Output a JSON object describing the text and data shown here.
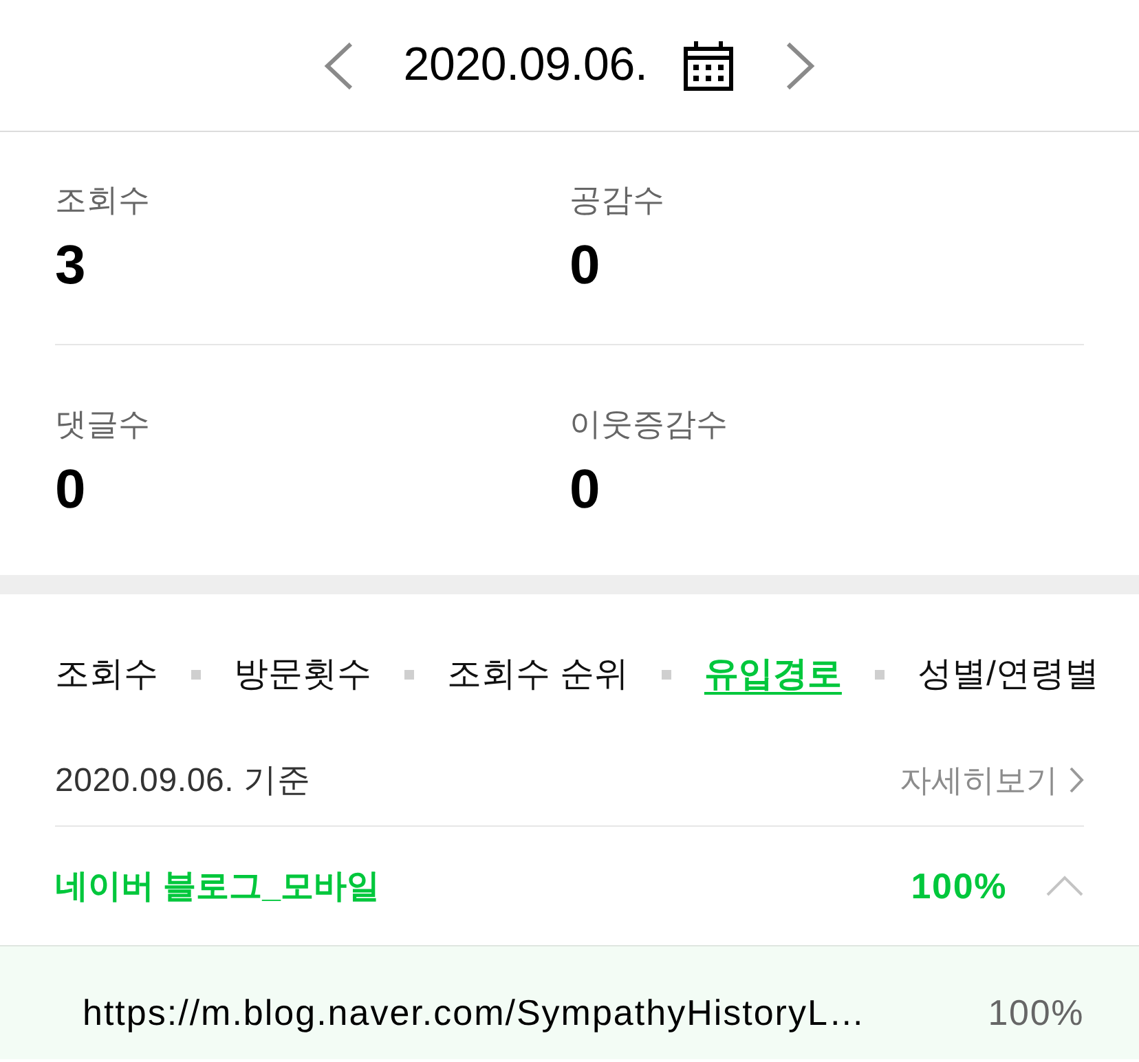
{
  "date_nav": {
    "date": "2020.09.06."
  },
  "stats": [
    {
      "label": "조회수",
      "value": "3"
    },
    {
      "label": "공감수",
      "value": "0"
    },
    {
      "label": "댓글수",
      "value": "0"
    },
    {
      "label": "이웃증감수",
      "value": "0"
    }
  ],
  "tabs": [
    {
      "label": "조회수",
      "selected": false
    },
    {
      "label": "방문횟수",
      "selected": false
    },
    {
      "label": "조회수 순위",
      "selected": false
    },
    {
      "label": "유입경로",
      "selected": true
    },
    {
      "label": "성별/연령별",
      "selected": false
    }
  ],
  "summary": {
    "basis": "2020.09.06. 기준",
    "details_link": "자세히보기"
  },
  "sources": [
    {
      "name": "네이버 블로그_모바일",
      "share": "100%",
      "expanded": true,
      "children": [
        {
          "url": "https://m.blog.naver.com/SympathyHistoryL…",
          "share": "100%"
        }
      ]
    }
  ]
}
